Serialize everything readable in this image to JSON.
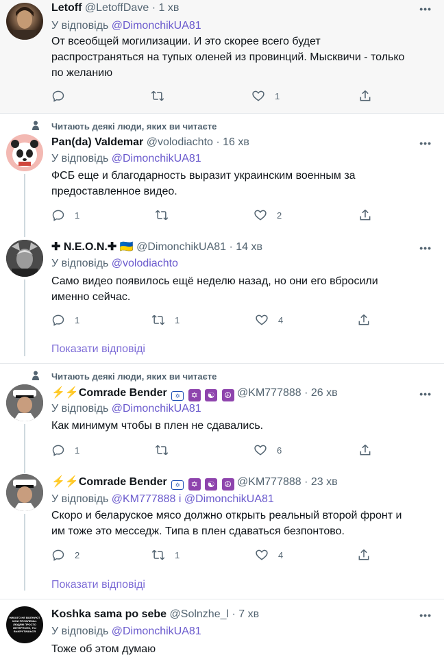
{
  "tweets": [
    {
      "name": "Letoff",
      "handle": "@LetoffDave",
      "dot": "·",
      "time": "1 хв",
      "reply_prefix": "У відповідь",
      "mention": "@DimonchikUA81",
      "text": "От всеобщей могилизации. И это скорее всего будет распространяться на тупых оленей из провинций. Мысквичи - только по желанию",
      "likes": "1"
    },
    {
      "social": "Читають деякі люди, яких ви читаєте",
      "name": "Pan(da) Valdemar",
      "handle": "@volodiachto",
      "dot": "·",
      "time": "16 хв",
      "reply_prefix": "У відповідь",
      "mention": "@DimonchikUA81",
      "text": "ФСБ еще и благодарность выразит украинским военным за предоставленное видео.",
      "replies": "1",
      "likes": "2"
    },
    {
      "name": "✚ N.E.O.N.✚",
      "flag": "🇺🇦",
      "handle": "@DimonchikUA81",
      "dot": "·",
      "time": "14 хв",
      "reply_prefix": "У відповідь",
      "mention": "@volodiachto",
      "text": "Само видео появилось ещё неделю назад, но они его вбросили именно сейчас.",
      "replies": "1",
      "retweets": "1",
      "likes": "4"
    },
    {
      "social": "Читають деякі люди, яких ви читаєте",
      "name": "⚡⚡Comrade Bender",
      "handle": "@KM777888",
      "dot": "·",
      "time": "26 хв",
      "reply_prefix": "У відповідь",
      "mention": "@DimonchikUA81",
      "text": "Как минимум чтобы в плен не сдавались.",
      "replies": "1",
      "likes": "6"
    },
    {
      "name": "⚡⚡Comrade Bender",
      "handle": "@KM777888",
      "dot": "·",
      "time": "23 хв",
      "reply_prefix": "У відповідь",
      "mention": "@KM777888",
      "and": "і",
      "mention2": "@DimonchikUA81",
      "text": "Скоро и беларуское мясо должно открыть реальный второй фронт и им тоже это месседж. Типа в плен сдаваться безпонтово.",
      "replies": "2",
      "retweets": "1",
      "likes": "4"
    },
    {
      "name": "Koshka sama po sebe",
      "handle": "@Solnzhe_l",
      "dot": "·",
      "time": "7 хв",
      "reply_prefix": "У відповідь",
      "mention": "@DimonchikUA81",
      "text": "Тоже об этом думаю",
      "avatar_text": "НИКОГО НЕ ВОЛНУЮТ МОИ ПРОБЛЕМЫ. ЛЮДЯМ ПРОСТО ИНТЕРЕСНО, ТЫ ВЫКРУТИШЬСЯ"
    }
  ],
  "show_replies": "Показати відповіді",
  "more_glyph": "•••",
  "badges": {
    "israel": "✡",
    "peace": "☮",
    "yinyang": "☯"
  },
  "colors": {
    "link": "#6a5acd",
    "muted": "#536471",
    "like_outline": "#536471"
  }
}
